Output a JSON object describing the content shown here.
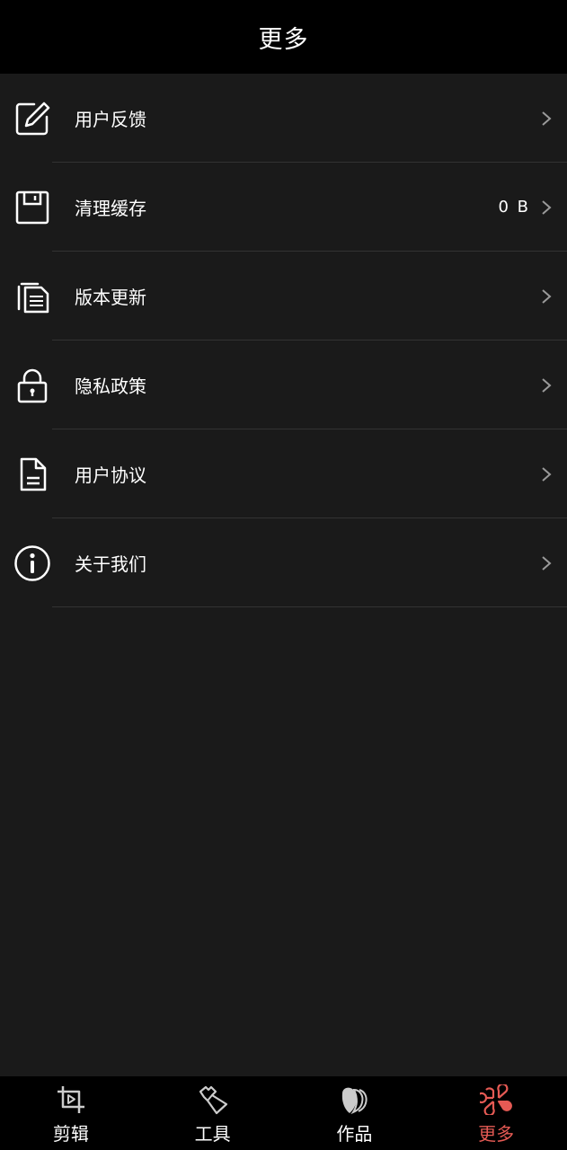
{
  "header": {
    "title": "更多"
  },
  "menu": {
    "items": [
      {
        "label": "用户反馈",
        "value": "",
        "icon": "edit-icon"
      },
      {
        "label": "清理缓存",
        "value": "0 B",
        "icon": "save-icon"
      },
      {
        "label": "版本更新",
        "value": "",
        "icon": "copy-icon"
      },
      {
        "label": "隐私政策",
        "value": "",
        "icon": "lock-icon"
      },
      {
        "label": "用户协议",
        "value": "",
        "icon": "document-icon"
      },
      {
        "label": "关于我们",
        "value": "",
        "icon": "info-icon"
      }
    ]
  },
  "tabbar": {
    "tabs": [
      {
        "label": "剪辑",
        "icon": "crop-play-icon",
        "active": false
      },
      {
        "label": "工具",
        "icon": "tools-icon",
        "active": false
      },
      {
        "label": "作品",
        "icon": "works-icon",
        "active": false
      },
      {
        "label": "更多",
        "icon": "more-grid-icon",
        "active": true
      }
    ]
  },
  "colors": {
    "background": "#1a1a1a",
    "bar": "#000000",
    "divider": "#333333",
    "accent": "#e55a54",
    "text": "#ffffff"
  }
}
